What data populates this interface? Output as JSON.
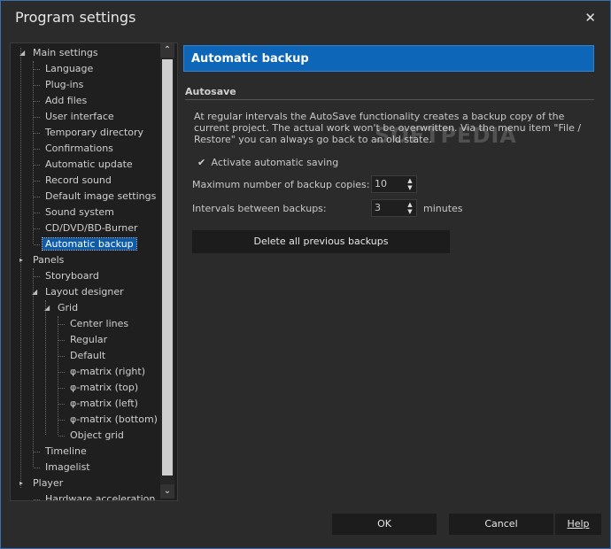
{
  "window": {
    "title": "Program settings",
    "close_icon": "close-icon"
  },
  "tree": {
    "items": [
      {
        "label": "Main settings",
        "expander": ""
      },
      {
        "label": "Language"
      },
      {
        "label": "Plug-ins"
      },
      {
        "label": "Add files"
      },
      {
        "label": "User interface"
      },
      {
        "label": "Temporary directory"
      },
      {
        "label": "Confirmations"
      },
      {
        "label": "Automatic update"
      },
      {
        "label": "Record sound"
      },
      {
        "label": "Default image settings"
      },
      {
        "label": "Sound system"
      },
      {
        "label": "CD/DVD/BD-Burner"
      },
      {
        "label": "Automatic backup"
      },
      {
        "label": "Panels"
      },
      {
        "label": "Storyboard"
      },
      {
        "label": "Layout designer"
      },
      {
        "label": "Grid"
      },
      {
        "label": "Center lines"
      },
      {
        "label": "Regular"
      },
      {
        "label": "Default"
      },
      {
        "label": "φ-matrix (right)"
      },
      {
        "label": "φ-matrix (top)"
      },
      {
        "label": "φ-matrix (left)"
      },
      {
        "label": "φ-matrix (bottom)"
      },
      {
        "label": "Object grid"
      },
      {
        "label": "Timeline"
      },
      {
        "label": "Imagelist"
      },
      {
        "label": "Player"
      },
      {
        "label": "Hardware acceleration"
      }
    ],
    "selected": "Automatic backup"
  },
  "scroll": {
    "up_glyph": "⌃",
    "down_glyph": "⌄"
  },
  "content": {
    "header": "Automatic backup",
    "group_title": "Autosave",
    "description": "At regular intervals the AutoSave functionality creates a backup copy of the current project. The actual work won't be overwritten. Via the menu item \"File / Restore\" you can always go back to an old state.",
    "checkbox_label": "Activate automatic saving",
    "checkbox_checked": true,
    "checkmark": "✔",
    "max_copies_label": "Maximum number of backup copies:",
    "max_copies_value": "10",
    "interval_label": "Intervals between backups:",
    "interval_value": "3",
    "interval_unit": "minutes",
    "delete_button": "Delete all previous backups"
  },
  "footer": {
    "ok": "OK",
    "cancel": "Cancel",
    "help": "Help"
  },
  "watermark": "SOFTPEDIA",
  "colors": {
    "accent": "#0e66b8",
    "background": "#2b2b2b",
    "selected": "#0e5ca8"
  }
}
